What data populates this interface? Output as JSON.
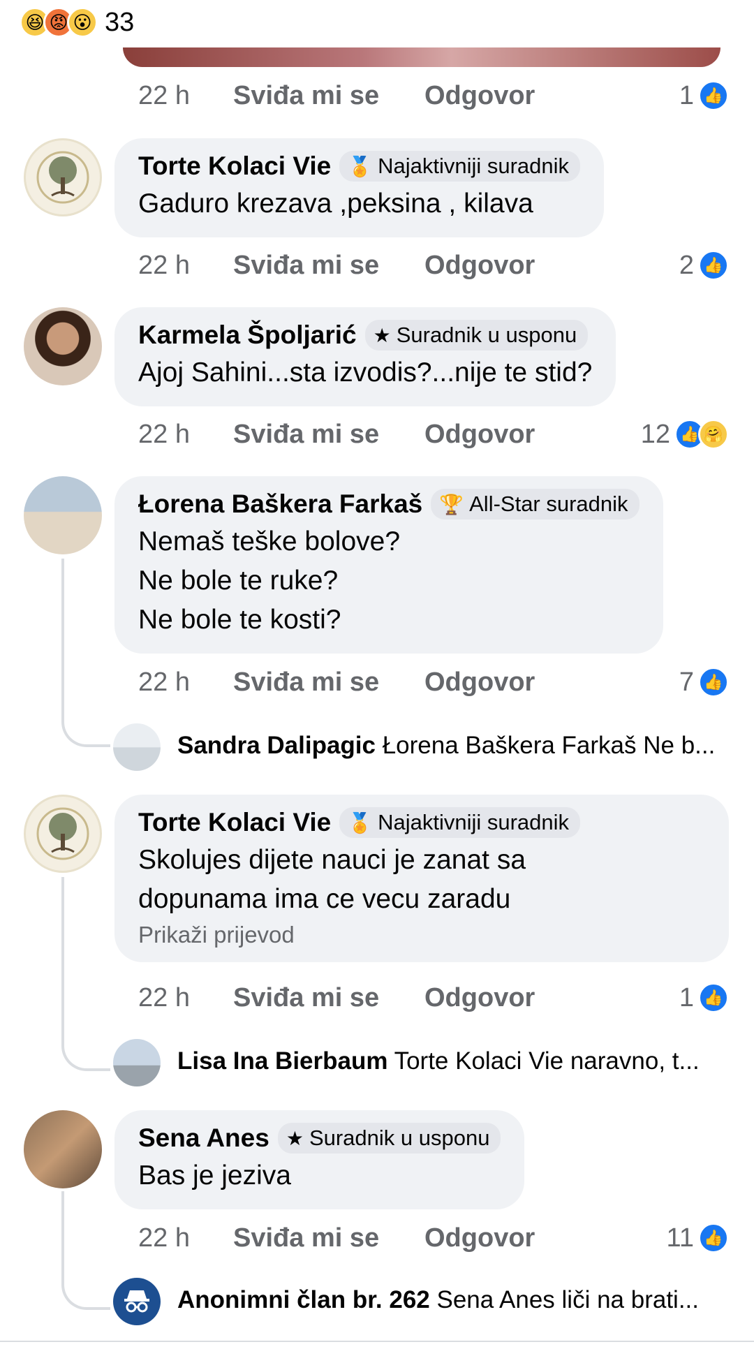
{
  "top_reactions": {
    "count": "33",
    "emojis": [
      "😆",
      "😡",
      "😮"
    ]
  },
  "comments": [
    {
      "time": "22 h",
      "like_label": "Sviđa mi se",
      "reply_label": "Odgovor",
      "reaction_count": "1"
    },
    {
      "author": "Torte Kolaci Vie",
      "badge": "Najaktivniji suradnik",
      "badge_icon": "🏅",
      "text": [
        "Gaduro krezava ,peksina , kilava"
      ],
      "time": "22 h",
      "like_label": "Sviđa mi se",
      "reply_label": "Odgovor",
      "reaction_count": "2"
    },
    {
      "author": "Karmela Špoljarić",
      "badge": "Suradnik u usponu",
      "badge_icon": "★",
      "text": [
        "Ajoj Sahini...sta izvodis?...nije te stid?"
      ],
      "time": "22 h",
      "like_label": "Sviđa mi se",
      "reply_label": "Odgovor",
      "reaction_count": "12"
    },
    {
      "author": "Łorena Baškera Farkaš",
      "badge": "All-Star suradnik",
      "badge_icon": "🏆",
      "text": [
        "Nemaš teške bolove?",
        "Ne bole te ruke?",
        "Ne bole te kosti?"
      ],
      "time": "22 h",
      "like_label": "Sviđa mi se",
      "reply_label": "Odgovor",
      "reaction_count": "7",
      "reply": {
        "author": "Sandra Dalipagic",
        "text": "Łorena Baškera Farkaš Ne b..."
      }
    },
    {
      "author": "Torte Kolaci Vie",
      "badge": "Najaktivniji suradnik",
      "badge_icon": "🏅",
      "text": [
        "Skolujes dijete nauci je zanat sa",
        "dopunama ima ce vecu zaradu"
      ],
      "translate": "Prikaži prijevod",
      "time": "22 h",
      "like_label": "Sviđa mi se",
      "reply_label": "Odgovor",
      "reaction_count": "1",
      "reply": {
        "author": "Lisa Ina Bierbaum",
        "text": "Torte Kolaci Vie naravno, t..."
      }
    },
    {
      "author": "Sena Anes",
      "badge": "Suradnik u usponu",
      "badge_icon": "★",
      "text": [
        "Bas je jeziva"
      ],
      "time": "22 h",
      "like_label": "Sviđa mi se",
      "reply_label": "Odgovor",
      "reaction_count": "11",
      "reply": {
        "author": "Anonimni član br. 262",
        "text": "Sena Anes liči na brati..."
      }
    }
  ],
  "colors": {
    "bubble": "#f0f2f5",
    "secondary_text": "#65676b",
    "like_blue": "#1877f2",
    "anon_avatar": "#1d4f91"
  }
}
